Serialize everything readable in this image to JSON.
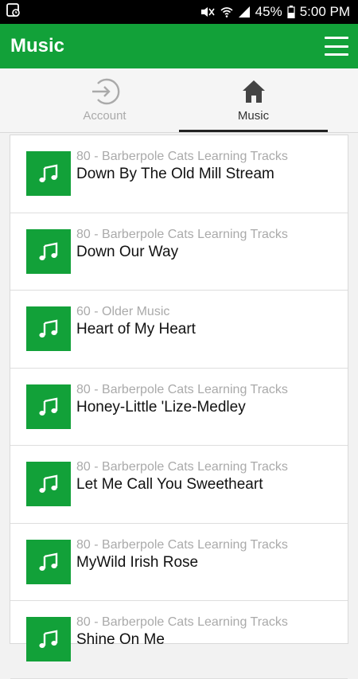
{
  "status_bar": {
    "battery": "45%",
    "time": "5:00 PM",
    "icons": [
      "notification-icon",
      "mute-icon",
      "wifi-icon",
      "signal-icon",
      "battery-icon"
    ]
  },
  "app_bar": {
    "title": "Music",
    "menu_icon": "hamburger-menu-icon"
  },
  "tabs": [
    {
      "label": "Account",
      "icon": "login-icon",
      "selected": false
    },
    {
      "label": "Music",
      "icon": "home-icon",
      "selected": true
    }
  ],
  "tracks": [
    {
      "category": "80 - Barberpole Cats Learning Tracks",
      "title": "Down By The Old Mill Stream"
    },
    {
      "category": "80 - Barberpole Cats Learning Tracks",
      "title": "Down Our Way"
    },
    {
      "category": "60 - Older Music",
      "title": "Heart of My Heart"
    },
    {
      "category": "80 - Barberpole Cats Learning Tracks",
      "title": "Honey-Little 'Lize-Medley"
    },
    {
      "category": "80 - Barberpole Cats Learning Tracks",
      "title": "Let Me Call You Sweetheart"
    },
    {
      "category": "80 - Barberpole Cats Learning Tracks",
      "title": "MyWild Irish Rose"
    },
    {
      "category": "80 - Barberpole Cats Learning Tracks",
      "title": "Shine On Me"
    }
  ],
  "colors": {
    "accent": "#12a139",
    "status_bar": "#000000",
    "muted_text": "#aaaaaa"
  }
}
